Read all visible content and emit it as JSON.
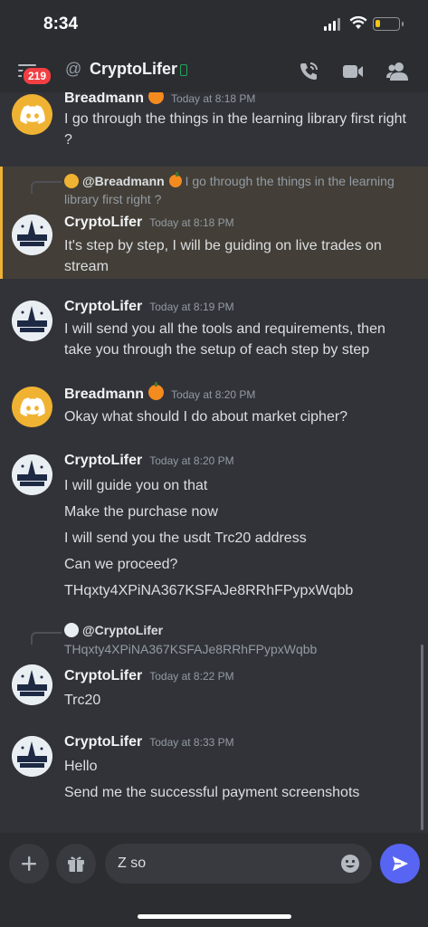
{
  "status_bar": {
    "time": "8:34",
    "battery_level": 0.2,
    "battery_color": "#f0c419",
    "icons": [
      "signal-icon",
      "wifi-icon",
      "battery-icon"
    ]
  },
  "header": {
    "menu_icon": "hamburger-menu-icon",
    "unread_badge": "219",
    "at_symbol": "@",
    "title": "CryptoLifer",
    "status_icon": "mobile-online-icon",
    "actions": [
      "voice-call-icon",
      "video-call-icon",
      "members-icon"
    ]
  },
  "messages": [
    {
      "author": "Breadmann",
      "author_emoji": "pumpkin",
      "timestamp": "Today at 8:18 PM",
      "avatar": "discord-avatar",
      "lines": [
        "I go through the things in the learning library first right ?"
      ]
    },
    {
      "reply": {
        "mention": "@Breadmann",
        "emoji": "pumpkin",
        "preview": "I go through the things in the learning library first right ?"
      },
      "author": "CryptoLifer",
      "timestamp": "Today at 8:18 PM",
      "avatar": "cryptolifer-avatar",
      "highlighted": true,
      "highlight_color": "#f0b232",
      "lines": [
        "It's step by step, I will be guiding on live trades on stream"
      ]
    },
    {
      "author": "CryptoLifer",
      "timestamp": "Today at 8:19 PM",
      "avatar": "cryptolifer-avatar",
      "lines": [
        "I will send you all the tools and requirements, then take you through the setup of each step by step"
      ]
    },
    {
      "author": "Breadmann",
      "author_emoji": "pumpkin",
      "timestamp": "Today at 8:20 PM",
      "avatar": "discord-avatar",
      "lines": [
        "Okay what should I do about market cipher?"
      ]
    },
    {
      "author": "CryptoLifer",
      "timestamp": "Today at 8:20 PM",
      "avatar": "cryptolifer-avatar",
      "lines": [
        "I will guide you on that",
        "Make the purchase now",
        "I will send you the usdt Trc20 address",
        "Can we proceed?",
        "THqxty4XPiNA367KSFAJe8RRhFPypxWqbb"
      ]
    },
    {
      "reply": {
        "mention": "@CryptoLifer",
        "preview": "THqxty4XPiNA367KSFAJe8RRhFPypxWqbb"
      },
      "author": "CryptoLifer",
      "timestamp": "Today at 8:22 PM",
      "avatar": "cryptolifer-avatar",
      "lines": [
        "Trc20"
      ]
    },
    {
      "author": "CryptoLifer",
      "timestamp": "Today at 8:33 PM",
      "avatar": "cryptolifer-avatar",
      "lines": [
        "Hello",
        "Send me the successful payment screenshots"
      ]
    }
  ],
  "composer": {
    "value": "Z so",
    "buttons": [
      "plus-icon",
      "gift-icon",
      "emoji-icon",
      "send-icon"
    ],
    "send_color": "#5865f2"
  },
  "colors": {
    "background": "#313338",
    "header": "#2b2d31",
    "badge": "#f23f43",
    "discord_avatar": "#f0b232"
  }
}
